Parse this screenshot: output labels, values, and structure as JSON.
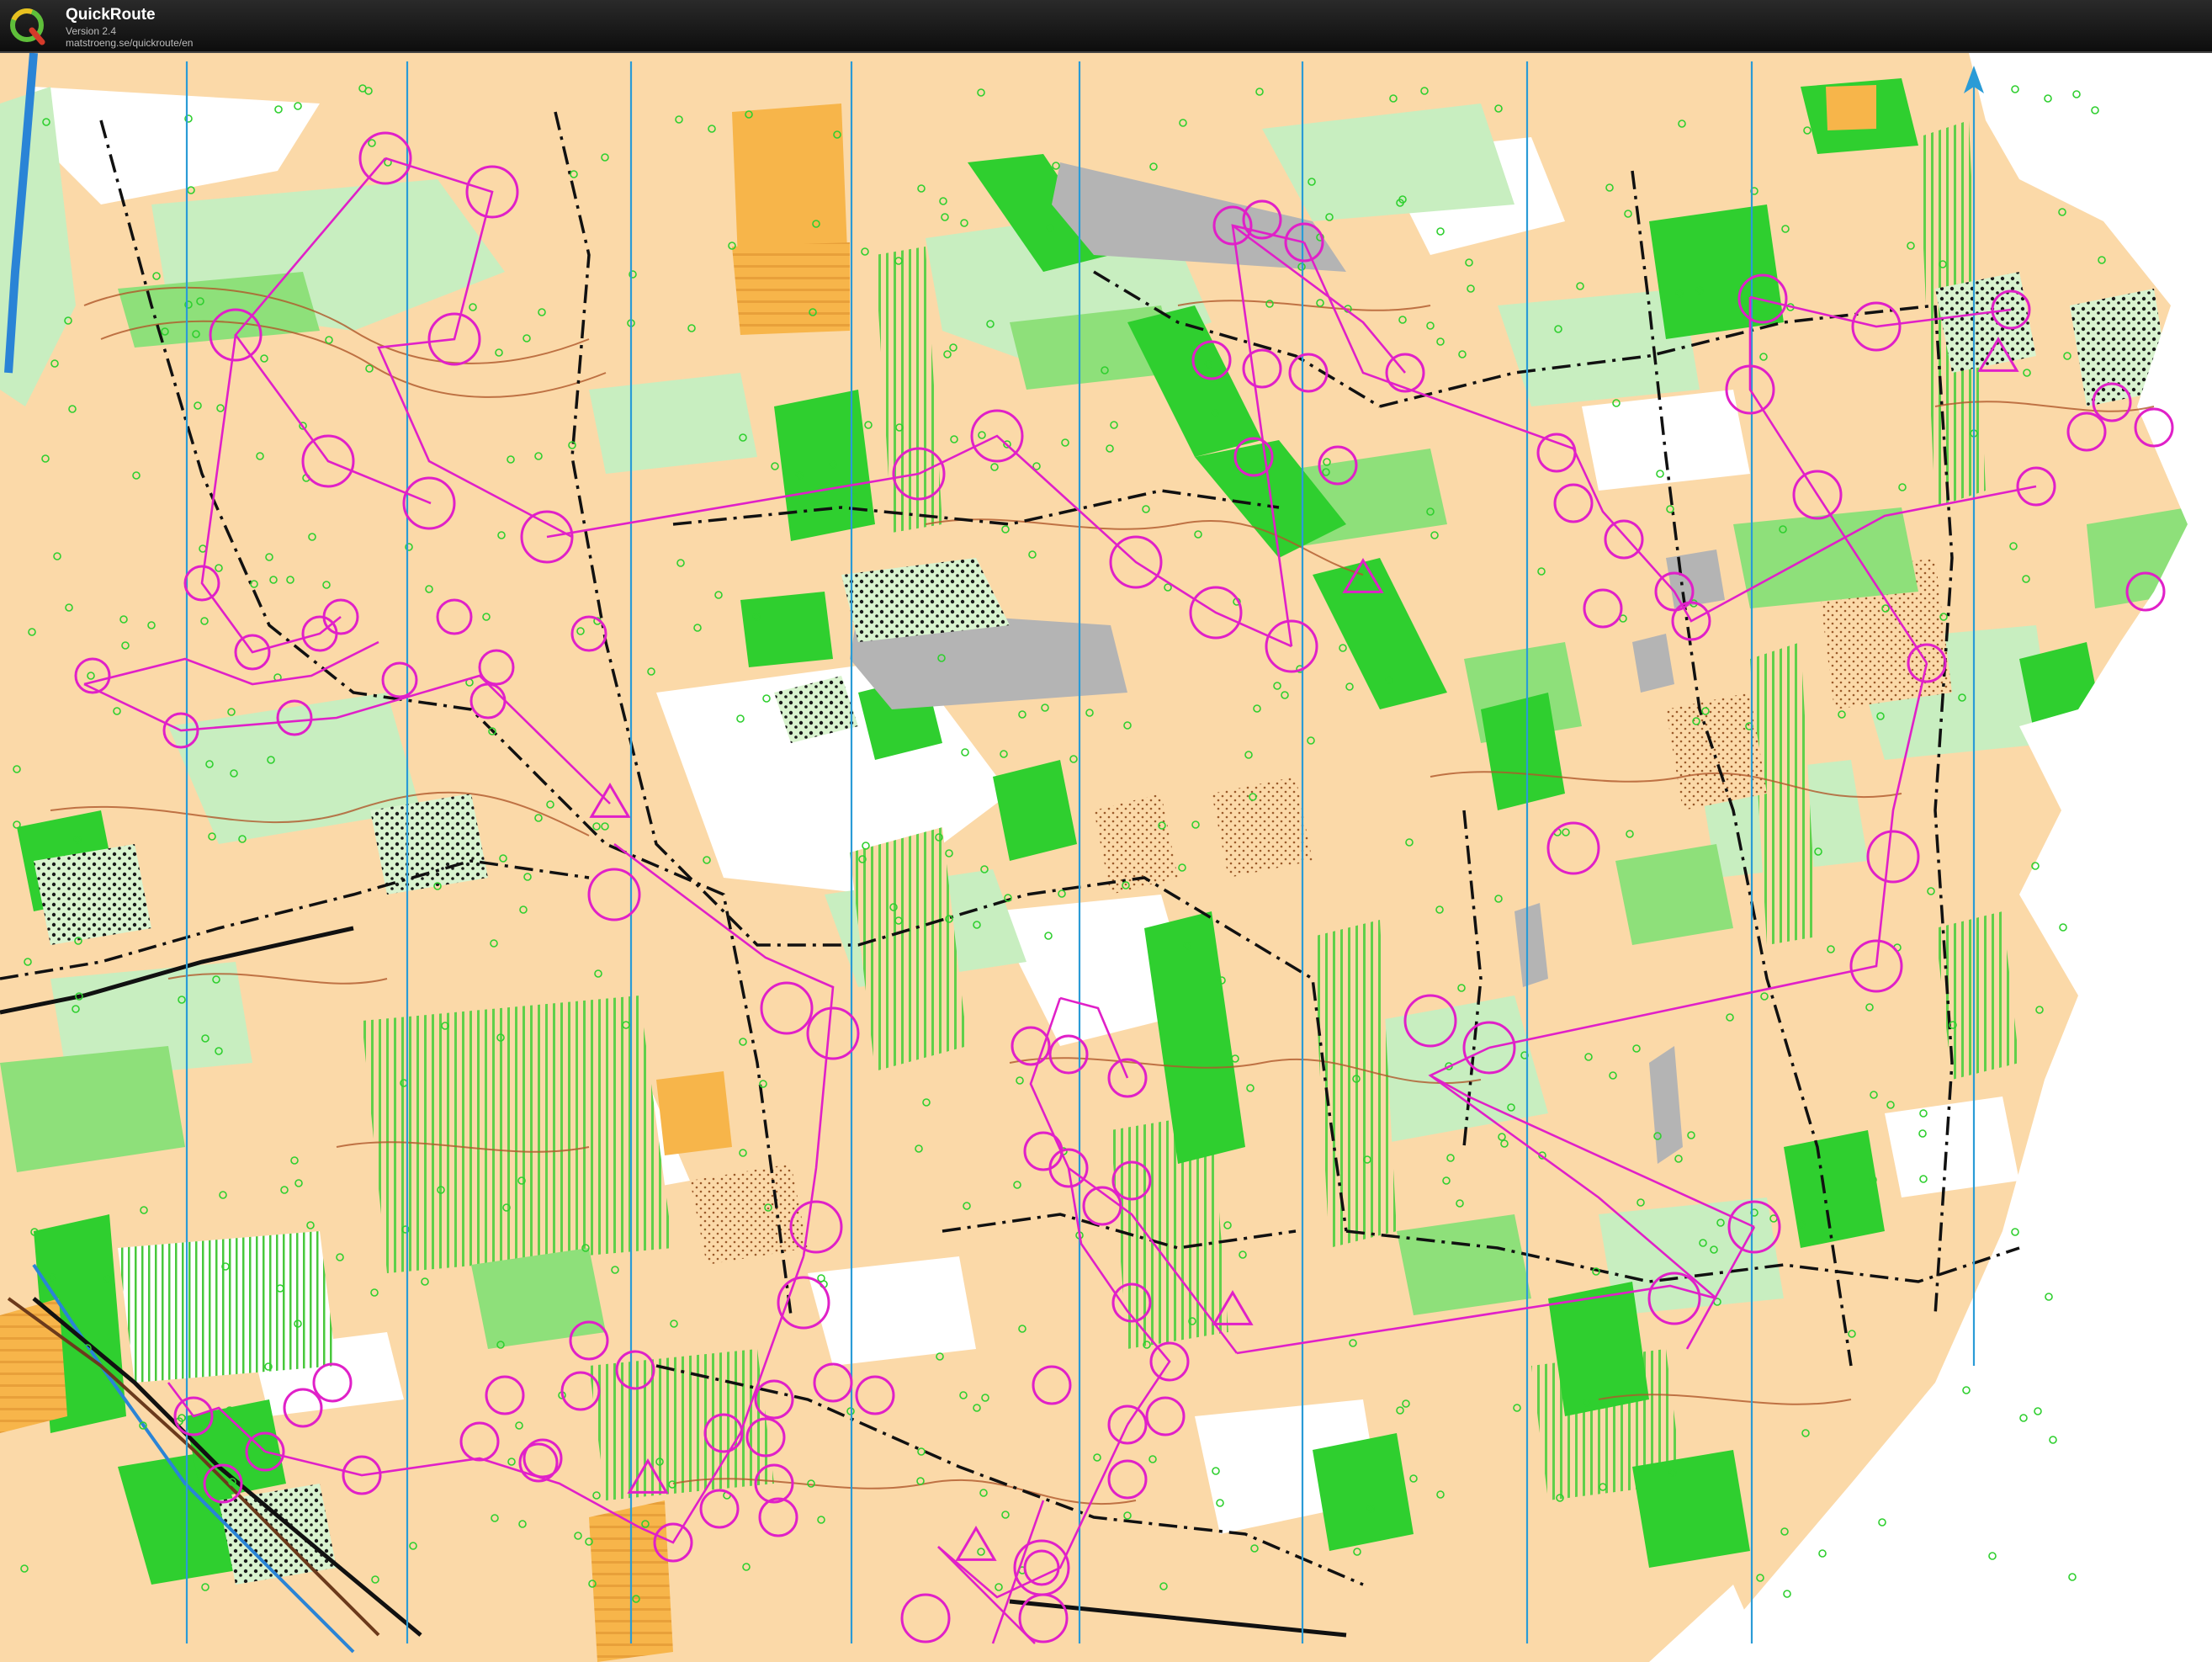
{
  "app": {
    "name": "QuickRoute",
    "version": "Version 2.4",
    "url": "matstroeng.se/quickroute/en",
    "logo_letter": "Q",
    "logo_icon": "quickroute-q-logo"
  },
  "map": {
    "type": "orienteering-map",
    "north_arrow": "north-arrow-icon",
    "colors": {
      "course": "#e020c8",
      "open_land": "#f8c891",
      "rough_open": "#fbd9a8",
      "forest_white": "#ffffff",
      "green_light": "#c8eec0",
      "green_medium": "#8ee07a",
      "green_dark": "#2fcf2f",
      "yellow_field": "#f7b54a",
      "rock_grey": "#b4b4b4",
      "contour_brown": "#b0582a",
      "track_black": "#111111",
      "magnetic_north": "#2a9bd6",
      "water_blue": "#2a84d6"
    }
  }
}
